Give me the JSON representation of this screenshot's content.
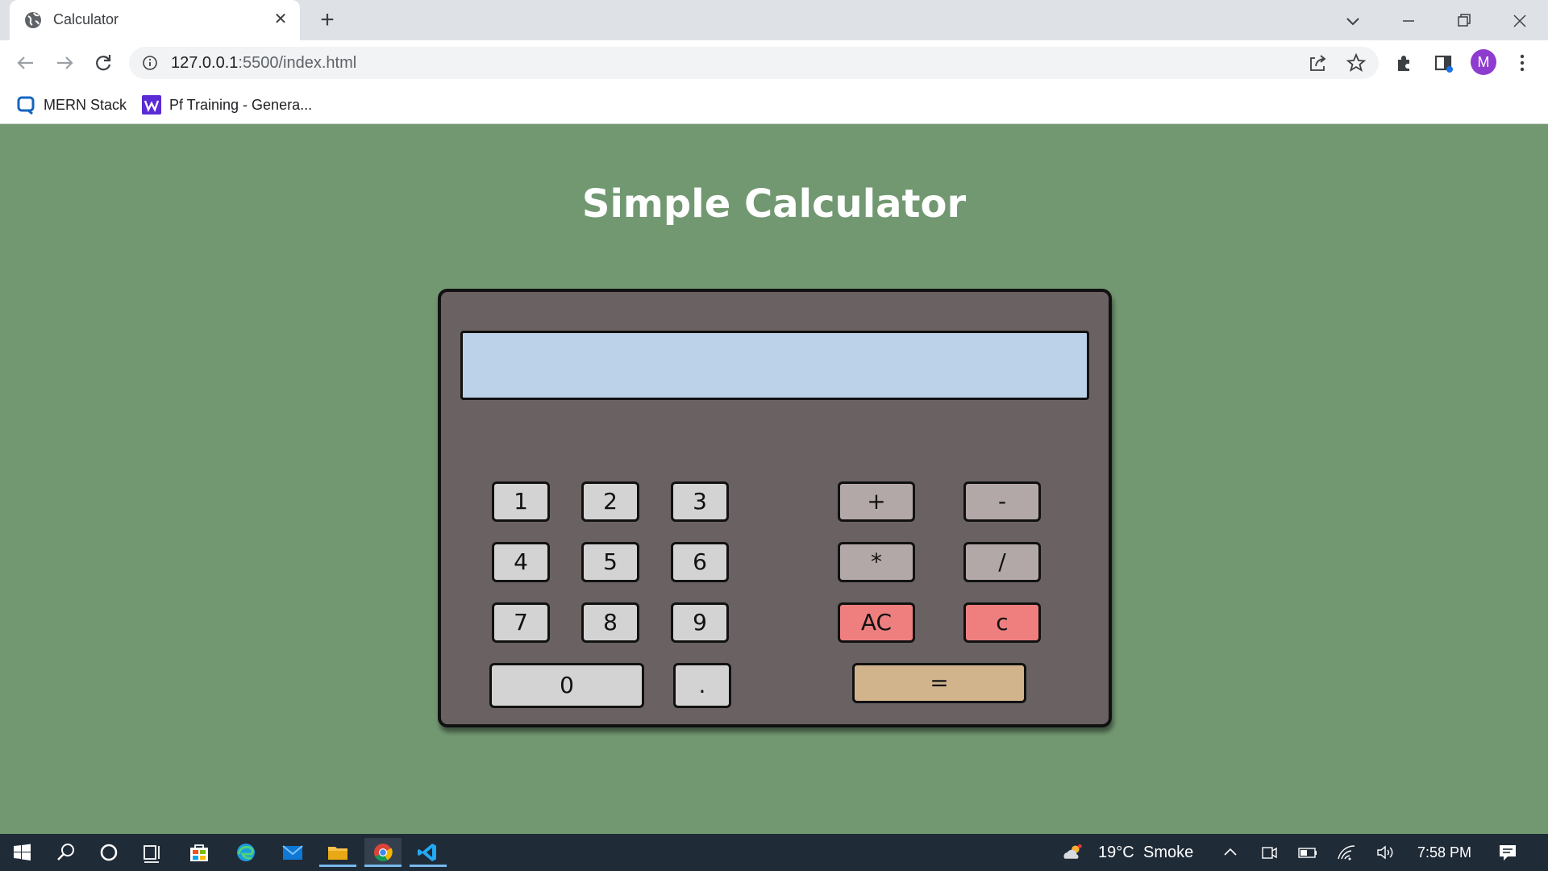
{
  "browser": {
    "tab_title": "Calculator",
    "tab_close": "✕",
    "new_tab": "+",
    "url_host": "127.0.0.1",
    "url_rest": ":5500/index.html",
    "avatar_letter": "M",
    "bookmarks": [
      {
        "label": "MERN Stack",
        "icon": "mern-bookmark-icon"
      },
      {
        "label": "Pf Training - Genera...",
        "icon": "w-bookmark-icon"
      }
    ]
  },
  "page": {
    "heading": "Simple Calculator",
    "display_value": ""
  },
  "keys": {
    "k1": "1",
    "k2": "2",
    "k3": "3",
    "k4": "4",
    "k5": "5",
    "k6": "6",
    "k7": "7",
    "k8": "8",
    "k9": "9",
    "k0": "0",
    "dot": ".",
    "plus": "+",
    "minus": "-",
    "multiply": "*",
    "divide": "/",
    "all_clear": "AC",
    "clear": "c",
    "equals": "="
  },
  "taskbar": {
    "weather_temp": "19°C",
    "weather_desc": "Smoke",
    "time": "7:58 PM"
  },
  "colors": {
    "page_bg": "#729872",
    "calc_body": "#6a6262",
    "display_bg": "#bcd2e8",
    "num_key": "#d3d3d3",
    "op_key": "#b3a8a8",
    "clear_key": "#ef7f7f",
    "equals_key": "#d1b38c"
  }
}
